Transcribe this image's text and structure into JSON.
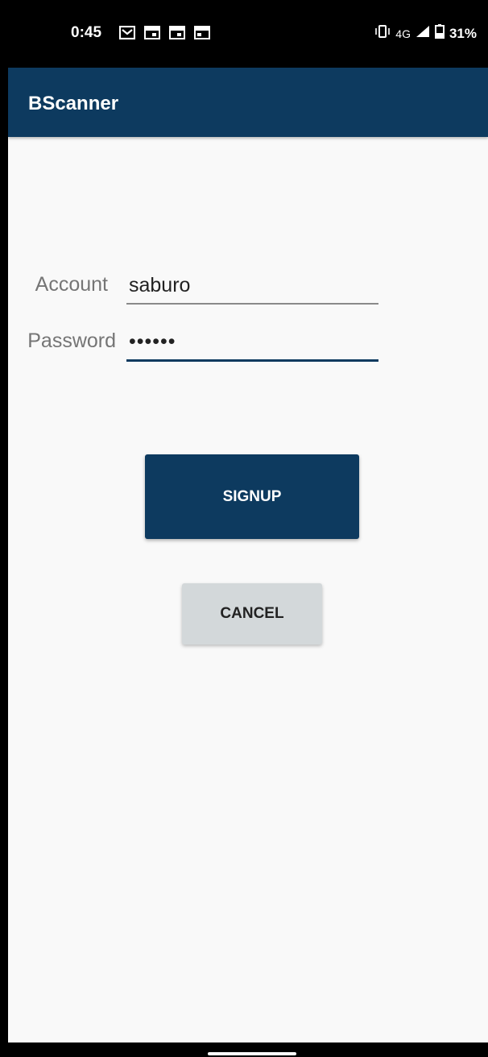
{
  "status_bar": {
    "time": "0:45",
    "network": "4G",
    "battery": "31%",
    "notification_icons": [
      "gmail-icon",
      "calendar-icon",
      "calendar-icon",
      "calendar-icon"
    ]
  },
  "app_bar": {
    "title": "BScanner"
  },
  "form": {
    "account_label": "Account",
    "account_value": "saburo",
    "password_label": "Password",
    "password_masked": "••••••"
  },
  "buttons": {
    "signup_label": "SIGNUP",
    "cancel_label": "CANCEL"
  },
  "colors": {
    "primary": "#0d3a5f",
    "background": "#f9f9f9",
    "secondary_button": "#d3d8da"
  }
}
